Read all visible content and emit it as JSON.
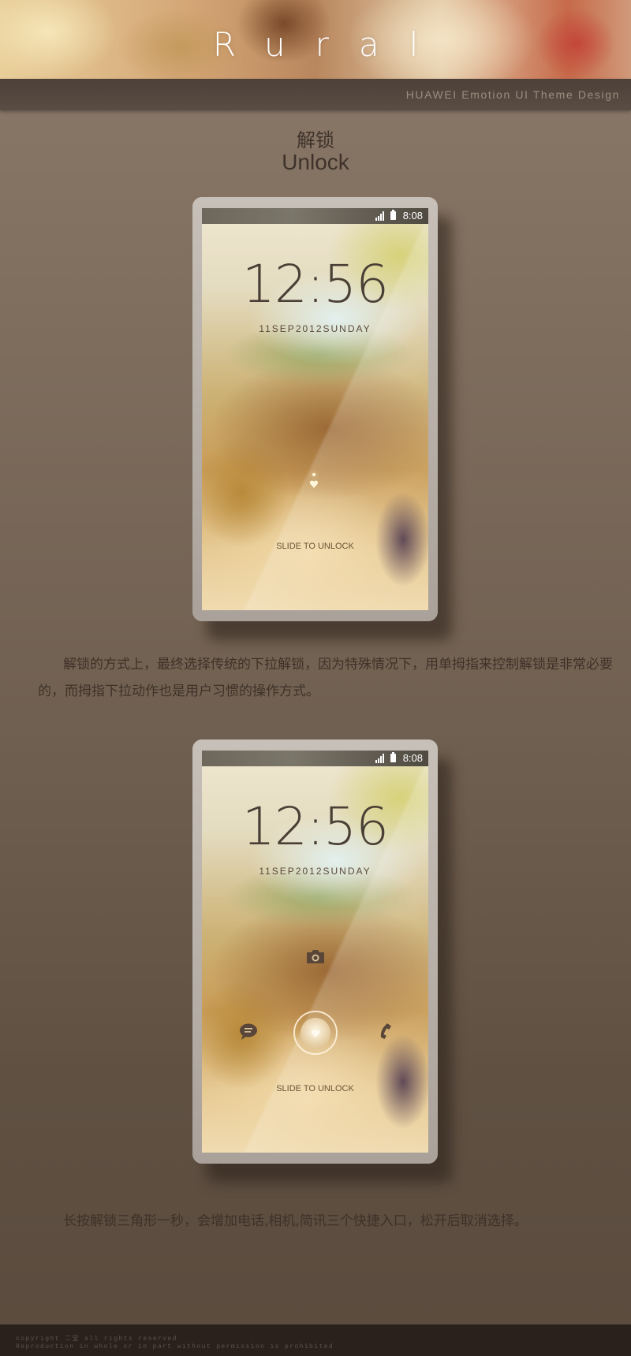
{
  "header": {
    "title": "Rural",
    "subtitle": "HUAWEI Emotion UI Theme Design"
  },
  "section": {
    "title_cn": "解锁",
    "title_en": "Unlock"
  },
  "phones": [
    {
      "status_time": "8:08",
      "clock": "12:56",
      "date": "11SEP2012SUNDAY",
      "slide_text": "SLIDE TO UNLOCK",
      "icons": [
        "signal-icon",
        "battery-icon",
        "heart-unlock-icon"
      ]
    },
    {
      "status_time": "8:08",
      "clock": "12:56",
      "date": "11SEP2012SUNDAY",
      "slide_text": "SLIDE TO UNLOCK",
      "icons": [
        "signal-icon",
        "battery-icon",
        "camera-icon",
        "message-icon",
        "unlock-ring-icon",
        "phone-icon"
      ]
    }
  ],
  "descriptions": {
    "first": "解锁的方式上，最终选择传统的下拉解锁，因为特殊情况下，用单拇指来控制解锁是非常必要的，而拇指下拉动作也是用户习惯的操作方式。",
    "second": "长按解锁三角形一秒，会增加电话,相机,简讯三个快捷入口，松开后取消选择。"
  },
  "footer": {
    "line1": "copyright 二宝 all rights reserved",
    "line2": "Reproduction in whole or in part without permission is prohibited"
  },
  "colors": {
    "background": "#7e6d5d",
    "strip": "#4c4038",
    "footer": "#2a211c"
  }
}
